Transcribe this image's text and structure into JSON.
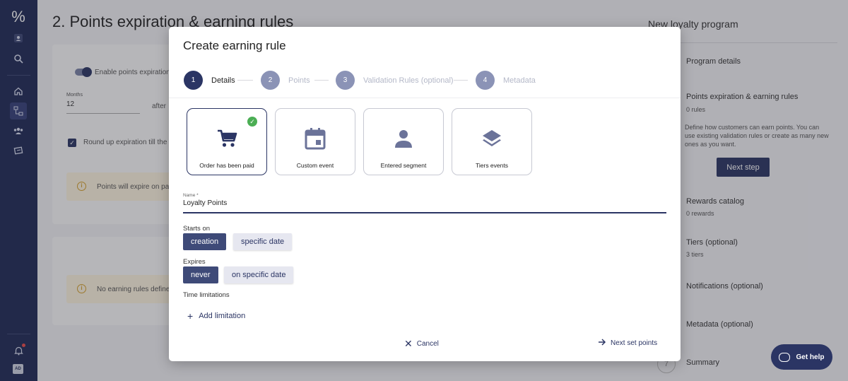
{
  "sidebar": {
    "icons": [
      "logo-percent-icon",
      "user-icon",
      "search-icon",
      "home-icon",
      "workflow-icon",
      "users-icon",
      "campaigns-icon",
      "bell-icon"
    ],
    "avatar": "AD"
  },
  "background": {
    "page_title": "2. Points expiration & earning rules",
    "toggle_label": "Enable points expiration",
    "months_label": "Months",
    "months_value": "12",
    "after_text": "after",
    "round_up_label": "Round up expiration till the",
    "warning1": "Points will expire on pa",
    "warning2": "No earning rules define"
  },
  "right_panel": {
    "title": "New loyalty program",
    "items": [
      {
        "label": "Program details",
        "sub": ""
      },
      {
        "label": "Points expiration & earning rules",
        "sub": "0 rules"
      },
      {
        "label": "Rewards catalog",
        "sub": "0 rewards"
      },
      {
        "label": "Tiers (optional)",
        "sub": "3 tiers"
      },
      {
        "label": "Notifications (optional)",
        "sub": ""
      },
      {
        "label": "Metadata (optional)",
        "sub": ""
      },
      {
        "label": "Summary",
        "sub": ""
      }
    ],
    "description": "Define how customers can earn points. You can use existing validation rules or create as many new ones as you want.",
    "next_button": "Next step",
    "summary_step": "7"
  },
  "help": {
    "label": "Get help"
  },
  "modal": {
    "title": "Create earning rule",
    "steps": [
      {
        "num": "1",
        "label": "Details",
        "active": true
      },
      {
        "num": "2",
        "label": "Points",
        "active": false
      },
      {
        "num": "3",
        "label": "Validation Rules (optional)",
        "active": false
      },
      {
        "num": "4",
        "label": "Metadata",
        "active": false
      }
    ],
    "cards": [
      {
        "label": "Order has been paid",
        "icon": "cart-icon",
        "selected": true
      },
      {
        "label": "Custom event",
        "icon": "calendar-icon",
        "selected": false
      },
      {
        "label": "Entered segment",
        "icon": "person-icon",
        "selected": false
      },
      {
        "label": "Tiers events",
        "icon": "layers-icon",
        "selected": false
      }
    ],
    "name_label": "Name *",
    "name_value": "Loyalty Points",
    "starts_on": {
      "label": "Starts on",
      "options": [
        "creation",
        "specific date"
      ],
      "selected": "creation"
    },
    "expires": {
      "label": "Expires",
      "options": [
        "never",
        "on specific date"
      ],
      "selected": "never"
    },
    "time_limitations_label": "Time limitations",
    "add_limitation": "Add limitation",
    "cancel": "Cancel",
    "next": "Next set points"
  },
  "colors": {
    "primary": "#2b3564",
    "sidebar": "#1f2a56",
    "success": "#4bae54",
    "warning": "#d39e2a"
  }
}
